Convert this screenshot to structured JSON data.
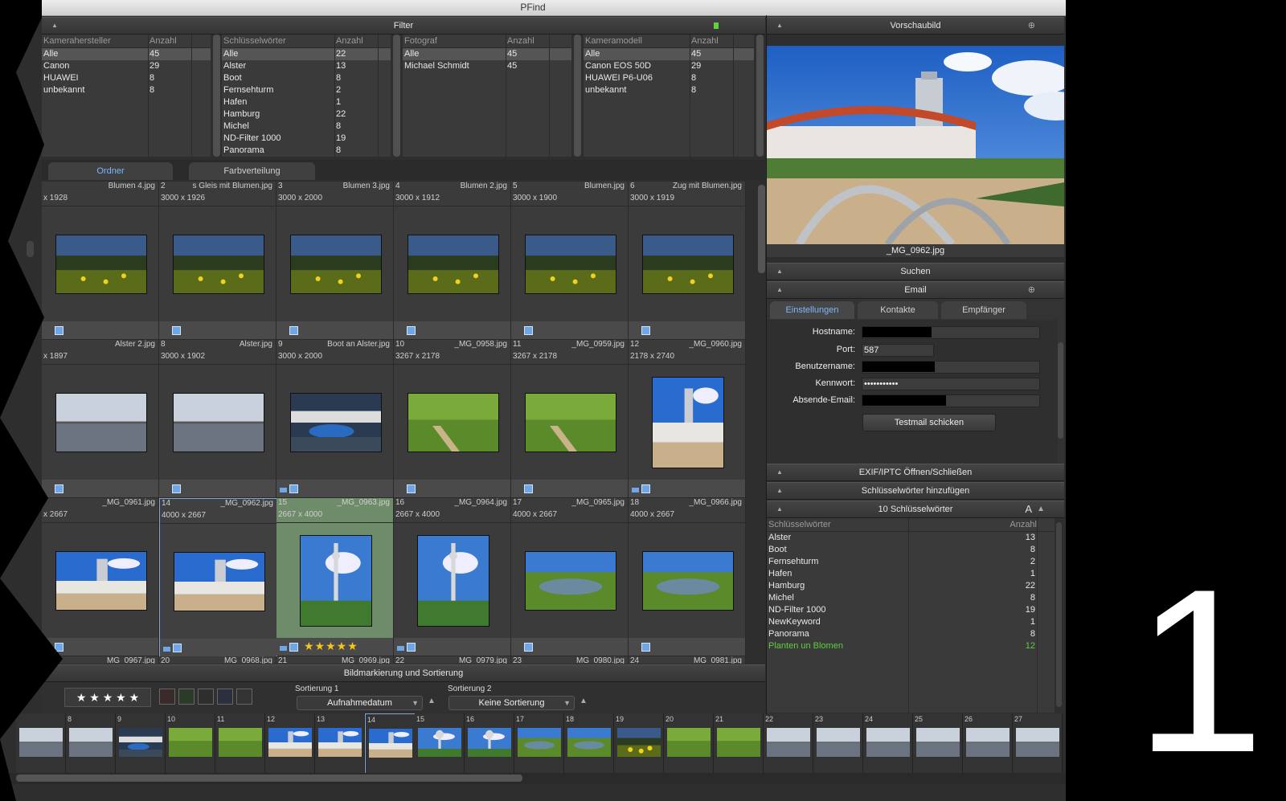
{
  "window": {
    "title": "PFind"
  },
  "filter": {
    "header": "Filter",
    "tables": [
      {
        "col1": "Kamerahersteller",
        "col2": "Anzahl",
        "rows": [
          [
            "Alle",
            "45"
          ],
          [
            "Canon",
            "29"
          ],
          [
            "HUAWEI",
            "8"
          ],
          [
            "unbekannt",
            "8"
          ]
        ]
      },
      {
        "col1": "Schlüsselwörter",
        "col2": "Anzahl",
        "rows": [
          [
            "Alle",
            "22"
          ],
          [
            "Alster",
            "13"
          ],
          [
            "Boot",
            "8"
          ],
          [
            "Fernsehturm",
            "2"
          ],
          [
            "Hafen",
            "1"
          ],
          [
            "Hamburg",
            "22"
          ],
          [
            "Michel",
            "8"
          ],
          [
            "ND-Filter 1000",
            "19"
          ],
          [
            "Panorama",
            "8"
          ]
        ]
      },
      {
        "col1": "Fotograf",
        "col2": "Anzahl",
        "rows": [
          [
            "Alle",
            "45"
          ],
          [
            "Michael Schmidt",
            "45"
          ]
        ]
      },
      {
        "col1": "Kameramodell",
        "col2": "Anzahl",
        "rows": [
          [
            "Alle",
            "45"
          ],
          [
            "Canon EOS 50D",
            "29"
          ],
          [
            "HUAWEI P6-U06",
            "8"
          ],
          [
            "unbekannt",
            "8"
          ]
        ]
      }
    ]
  },
  "tabs": {
    "folder": "Ordner",
    "colors": "Farbverteilung"
  },
  "grid": {
    "rows": [
      [
        {
          "num": "",
          "fn": "Blumen 4.jpg",
          "dim": "x 1928"
        },
        {
          "num": "2",
          "fn": "s Gleis mit Blumen.jpg",
          "dim": "3000 x 1926"
        },
        {
          "num": "3",
          "fn": "Blumen 3.jpg",
          "dim": "3000 x 2000"
        },
        {
          "num": "4",
          "fn": "Blumen 2.jpg",
          "dim": "3000 x 1912"
        },
        {
          "num": "5",
          "fn": "Blumen.jpg",
          "dim": "3000 x 1900"
        },
        {
          "num": "6",
          "fn": "Zug mit Blumen.jpg",
          "dim": "3000 x 1919"
        }
      ],
      [
        {
          "num": "",
          "fn": "Alster 2.jpg",
          "dim": "x 1897"
        },
        {
          "num": "8",
          "fn": "Alster.jpg",
          "dim": "3000 x 1902"
        },
        {
          "num": "9",
          "fn": "Boot an Alster.jpg",
          "dim": "3000 x 2000"
        },
        {
          "num": "10",
          "fn": "_MG_0958.jpg",
          "dim": "3267 x 2178"
        },
        {
          "num": "11",
          "fn": "_MG_0959.jpg",
          "dim": "3267 x 2178"
        },
        {
          "num": "12",
          "fn": "_MG_0960.jpg",
          "dim": "2178 x 2740"
        }
      ],
      [
        {
          "num": "",
          "fn": "_MG_0961.jpg",
          "dim": "x 2667"
        },
        {
          "num": "14",
          "fn": "_MG_0962.jpg",
          "dim": "4000 x 2667"
        },
        {
          "num": "15",
          "fn": "_MG_0963.jpg",
          "dim": "2667 x 4000"
        },
        {
          "num": "16",
          "fn": "_MG_0964.jpg",
          "dim": "2667 x 4000"
        },
        {
          "num": "17",
          "fn": "_MG_0965.jpg",
          "dim": "4000 x 2667"
        },
        {
          "num": "18",
          "fn": "_MG_0966.jpg",
          "dim": "4000 x 2667"
        }
      ]
    ],
    "partial_row": [
      {
        "num": "",
        "fn": "_MG_0967.jpg"
      },
      {
        "num": "20",
        "fn": "_MG_0968.jpg"
      },
      {
        "num": "21",
        "fn": "_MG_0969.jpg"
      },
      {
        "num": "22",
        "fn": "_MG_0979.jpg"
      },
      {
        "num": "23",
        "fn": "_MG_0980.jpg"
      },
      {
        "num": "24",
        "fn": "_MG_0981.jpg"
      }
    ],
    "rating_cell_stars": 5
  },
  "marking": {
    "header": "Bildmarkierung und Sortierung",
    "stars": "★ ★ ★ ★ ★",
    "sort1_label": "Sortierung 1",
    "sort1_value": "Aufnahmedatum",
    "sort2_label": "Sortierung 2",
    "sort2_value": "Keine Sortierung",
    "color_swatches": [
      "#3a2a2a",
      "#2c3a2a",
      "#2e2e2e",
      "#2a3040",
      "#333333"
    ]
  },
  "filmstrip": {
    "numbers": [
      "",
      "8",
      "9",
      "10",
      "11",
      "12",
      "13",
      "14",
      "15",
      "16",
      "17",
      "18",
      "19",
      "20",
      "21",
      "22",
      "23",
      "24",
      "25",
      "26",
      "27"
    ]
  },
  "preview": {
    "header": "Vorschaubild",
    "filename": "_MG_0962.jpg"
  },
  "search": {
    "header": "Suchen"
  },
  "email": {
    "header": "Email",
    "tabs": [
      "Einstellungen",
      "Kontakte",
      "Empfänger"
    ],
    "hostname_label": "Hostname:",
    "port_label": "Port:",
    "port_value": "587",
    "username_label": "Benutzername:",
    "password_label": "Kennwort:",
    "password_value": "•••••••••••",
    "sender_label": "Absende-Email:",
    "test_button": "Testmail schicken"
  },
  "exif": {
    "header": "EXIF/IPTC Öffnen/Schließen"
  },
  "addkw": {
    "header": "Schlüsselwörter hinzufügen"
  },
  "keywords": {
    "header": "10 Schlüsselwörter",
    "col1": "Schlüsselwörter",
    "col2": "Anzahl",
    "rows": [
      [
        "Alster",
        "13"
      ],
      [
        "Boot",
        "8"
      ],
      [
        "Fernsehturm",
        "2"
      ],
      [
        "Hafen",
        "1"
      ],
      [
        "Hamburg",
        "22"
      ],
      [
        "Michel",
        "8"
      ],
      [
        "ND-Filter 1000",
        "19"
      ],
      [
        "NewKeyword",
        "1"
      ],
      [
        "Panorama",
        "8"
      ],
      [
        "Planten un Blomen",
        "12"
      ]
    ],
    "highlight_color": "#5ecf3c"
  },
  "overlay_number": "1"
}
